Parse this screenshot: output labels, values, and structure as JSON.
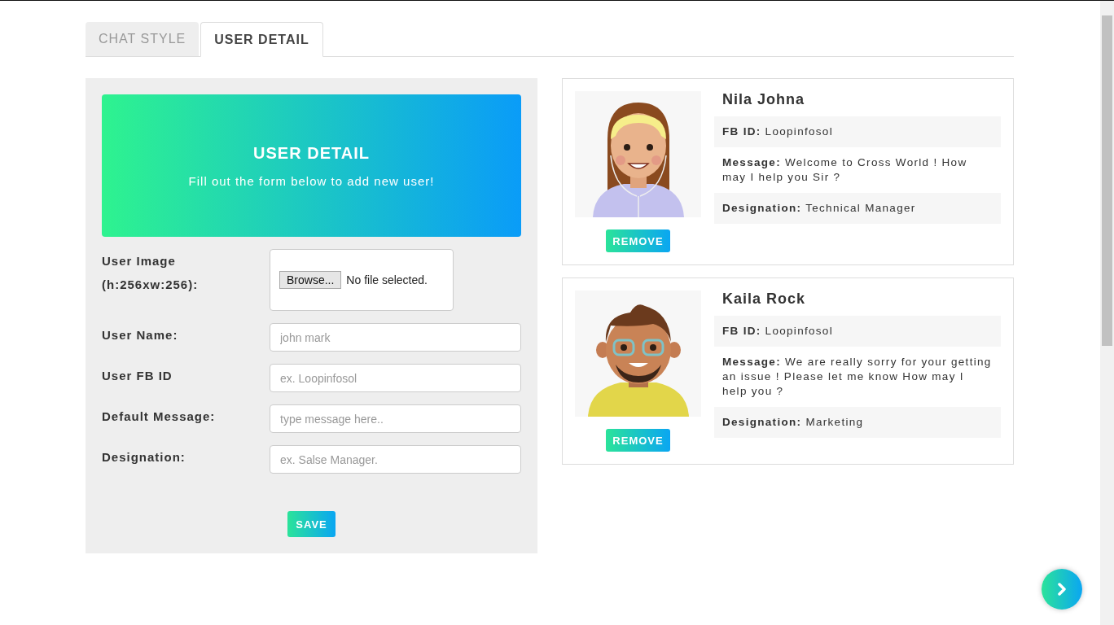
{
  "tabs": [
    {
      "label": "CHAT STYLE",
      "selected": false
    },
    {
      "label": "USER DETAIL",
      "selected": true
    }
  ],
  "form": {
    "banner": {
      "title": "USER DETAIL",
      "subtitle": "Fill out the form below to add new user!"
    },
    "fields": [
      {
        "kind": "file",
        "label": "User Image (h:256xw:256):",
        "button": "Browse...",
        "status": "No file selected."
      },
      {
        "kind": "text",
        "label": "User Name:",
        "placeholder": "john mark"
      },
      {
        "kind": "text",
        "label": "User FB ID",
        "placeholder": "ex. Loopinfosol"
      },
      {
        "kind": "text",
        "label": "Default Message:",
        "placeholder": "type message here.."
      },
      {
        "kind": "text",
        "label": "Designation:",
        "placeholder": "ex. Salse Manager."
      }
    ],
    "save_button": "SAVE"
  },
  "users": [
    {
      "kind": "woman",
      "name": "Nila Johna",
      "details": [
        "**FB ID:** Loopinfosol",
        "**Message:** Welcome to Cross World ! How may I help you Sir ?",
        "**Designation:** Technical Manager"
      ],
      "remove_button": "REMOVE"
    },
    {
      "kind": "man",
      "name": "Kaila Rock",
      "details": [
        "**FB ID:** Loopinfosol",
        "**Message:** We are really sorry for your getting an issue ! Please let me know How may I help you ?",
        "**Designation:** Marketing"
      ],
      "remove_button": "REMOVE"
    }
  ]
}
